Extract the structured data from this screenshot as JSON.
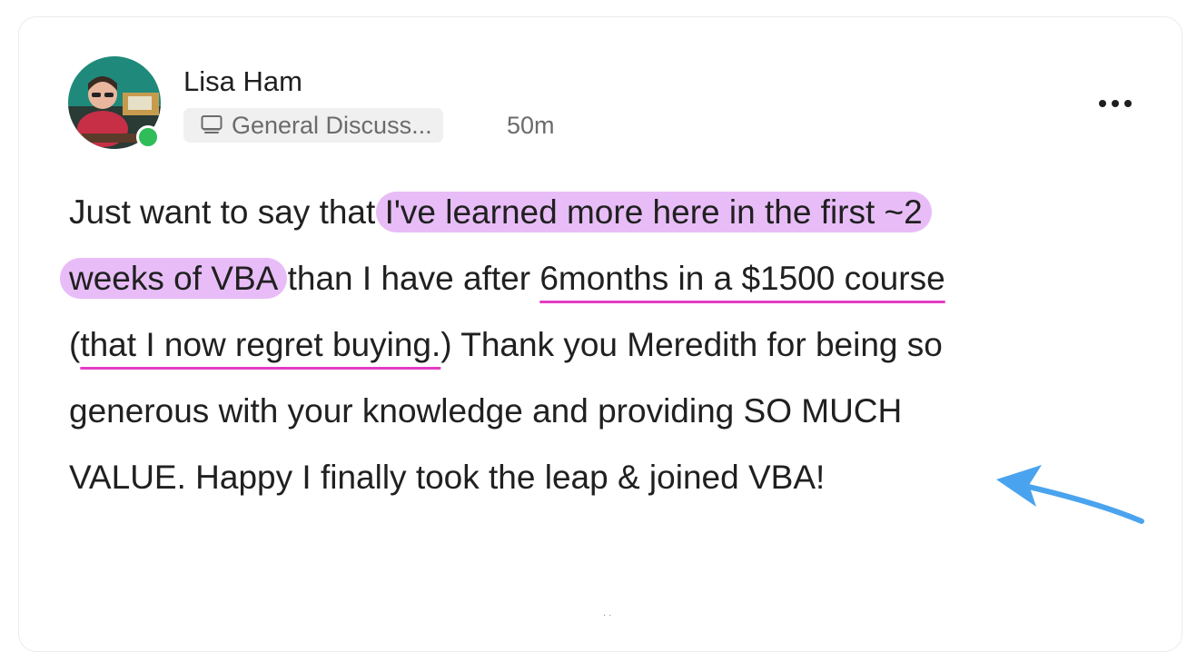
{
  "post": {
    "author": "Lisa Ham",
    "category": "General Discuss...",
    "time": "50m",
    "online": true,
    "more_icon": "more-horizontal-icon",
    "category_icon": "computer-icon",
    "lines": [
      {
        "plain1": "Just want to say that ",
        "highlight": "I've learned more here in the first ~2"
      },
      {
        "highlight": "weeks of VBA",
        "plain1": " than I have after ",
        "underline": "6months in a $1500 course"
      },
      {
        "plain0": "(",
        "underline": "that I now regret buying.",
        "plain1": ") Thank you Meredith for being so"
      },
      {
        "plain1": "generous with your knowledge and providing SO MUCH"
      },
      {
        "plain1": "VALUE. Happy I finally took the leap & joined VBA!"
      }
    ]
  },
  "annotations": {
    "highlight_color": "#e8bdf7",
    "underline_color": "#e43cc5",
    "arrow_color": "#4aa3ee"
  },
  "colors": {
    "online_dot": "#2ebd59",
    "text": "#202020",
    "muted": "#6b6b6b"
  }
}
